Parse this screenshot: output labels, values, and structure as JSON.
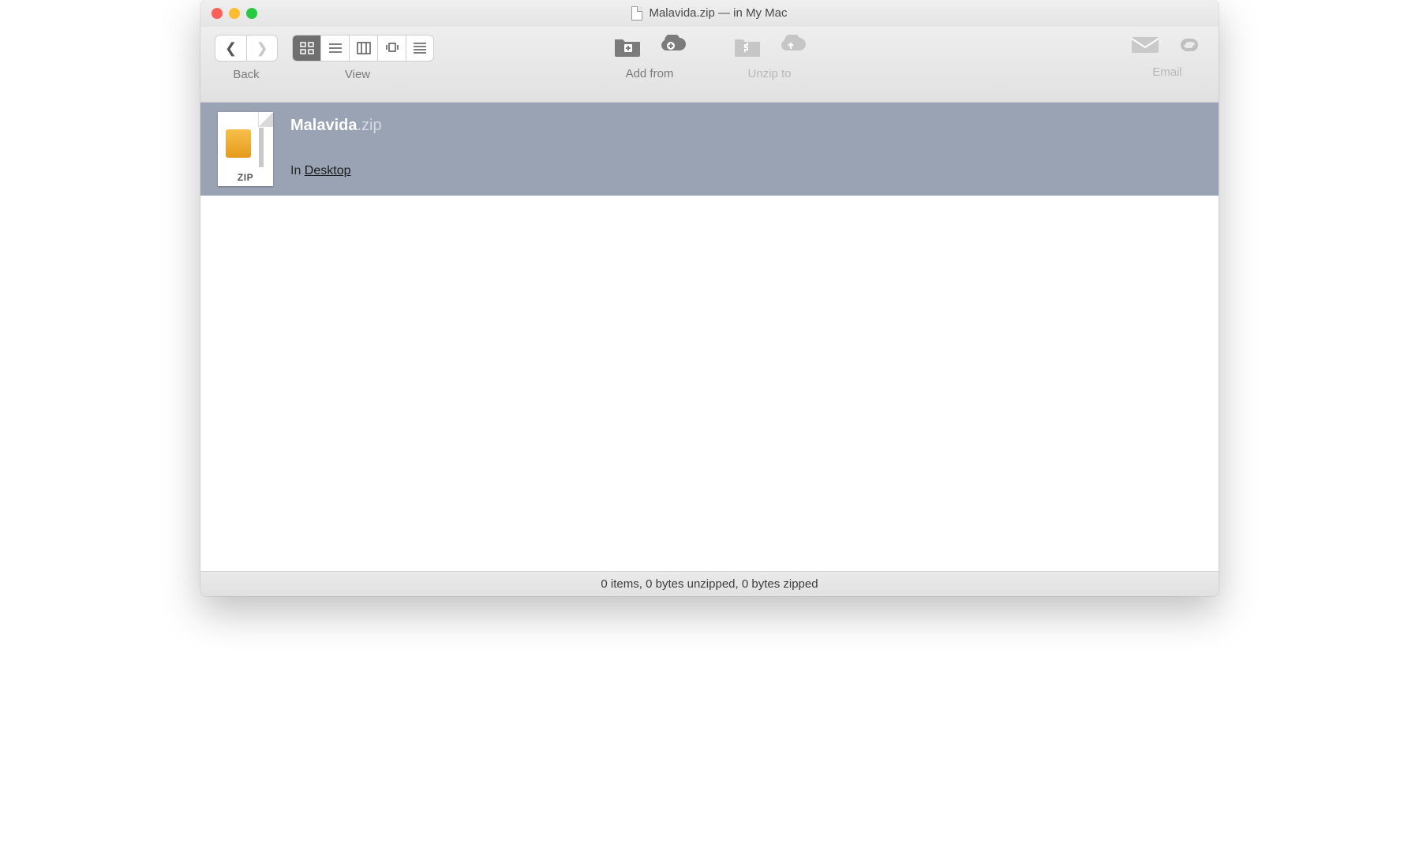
{
  "window": {
    "title": "Malavida.zip — in My Mac"
  },
  "toolbar": {
    "back_label": "Back",
    "view_label": "View",
    "addfrom_label": "Add from",
    "unzipto_label": "Unzip to",
    "email_label": "Email"
  },
  "file": {
    "name": "Malavida",
    "ext": ".zip",
    "ziptag": "ZIP",
    "location_prefix": "In ",
    "location_link": "Desktop"
  },
  "status": {
    "text": "0 items, 0 bytes unzipped, 0 bytes zipped"
  }
}
